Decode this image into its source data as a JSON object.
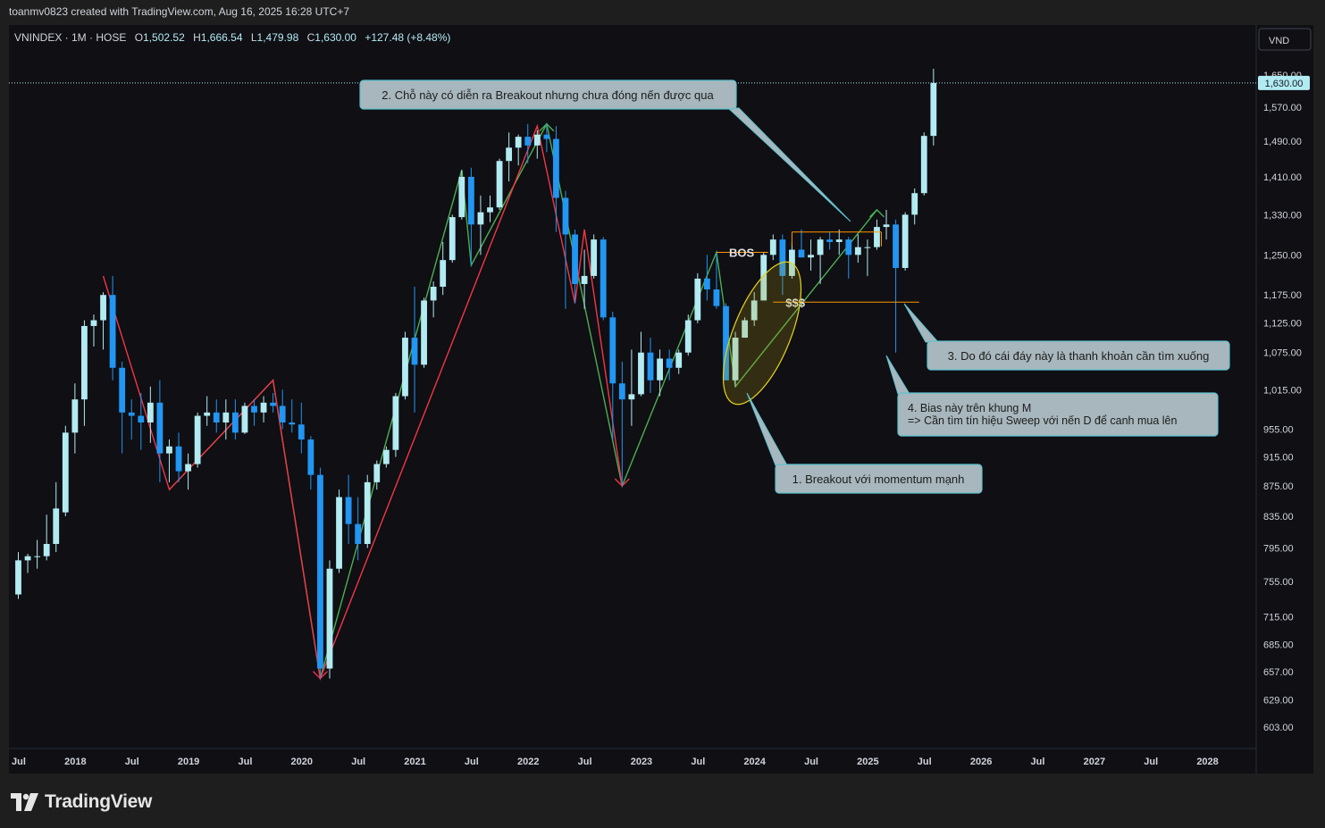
{
  "header": {
    "text": "toanmv0823 created with TradingView.com, Aug 16, 2025 16:28 UTC+7"
  },
  "legend": {
    "symbol": "VNINDEX · 1M · HOSE",
    "o_label": "O",
    "o_value": "1,502.52",
    "h_label": "H",
    "h_value": "1,666.54",
    "l_label": "L",
    "l_value": "1,479.98",
    "c_label": "C",
    "c_value": "1,630.00",
    "change": "+127.48 (+8.48%)"
  },
  "currency": "VND",
  "price_badge": "1,630.00",
  "footer": {
    "brand": "TradingView"
  },
  "colors": {
    "bg": "#0f0f14",
    "up": "#b2ebf2",
    "down": "#2196f3",
    "green_line": "#4caf50",
    "red_line": "#f23645",
    "annotation_bg": "#a8b7bd",
    "annotation_border": "#5dc2d0",
    "highlight_ellipse": "#e6d21a",
    "level_line": "#ff9800"
  },
  "chart_data": {
    "type": "candlestick",
    "symbol": "VNINDEX",
    "timeframe": "1M",
    "y_axis": {
      "scale": "log",
      "ticks": [
        "1,650.00",
        "1,570.00",
        "1,490.00",
        "1,410.00",
        "1,330.00",
        "1,250.00",
        "1,175.00",
        "1,125.00",
        "1,075.00",
        "1,015.00",
        "955.00",
        "915.00",
        "875.00",
        "835.00",
        "795.00",
        "755.00",
        "715.00",
        "685.00",
        "657.00",
        "629.00",
        "603.00"
      ]
    },
    "x_axis": {
      "ticks": [
        "Jul",
        "2018",
        "Jul",
        "2019",
        "Jul",
        "2020",
        "Jul",
        "2021",
        "Jul",
        "2022",
        "Jul",
        "2023",
        "Jul",
        "2024",
        "Jul",
        "2025",
        "Jul",
        "2026",
        "Jul",
        "2027",
        "Jul",
        "2028"
      ]
    },
    "candles": [
      {
        "t": "2017-07",
        "o": 740,
        "h": 790,
        "l": 735,
        "c": 780
      },
      {
        "t": "2017-08",
        "o": 780,
        "h": 788,
        "l": 765,
        "c": 785
      },
      {
        "t": "2017-09",
        "o": 785,
        "h": 805,
        "l": 770,
        "c": 785
      },
      {
        "t": "2017-10",
        "o": 785,
        "h": 837,
        "l": 780,
        "c": 800
      },
      {
        "t": "2017-11",
        "o": 800,
        "h": 880,
        "l": 790,
        "c": 845
      },
      {
        "t": "2017-12",
        "o": 840,
        "h": 960,
        "l": 835,
        "c": 950
      },
      {
        "t": "2018-01",
        "o": 950,
        "h": 1025,
        "l": 920,
        "c": 1000
      },
      {
        "t": "2018-02",
        "o": 1000,
        "h": 1130,
        "l": 960,
        "c": 1120
      },
      {
        "t": "2018-03",
        "o": 1120,
        "h": 1140,
        "l": 1085,
        "c": 1130
      },
      {
        "t": "2018-04",
        "o": 1130,
        "h": 1180,
        "l": 1080,
        "c": 1175
      },
      {
        "t": "2018-05",
        "o": 1175,
        "h": 1210,
        "l": 1030,
        "c": 1050
      },
      {
        "t": "2018-06",
        "o": 1050,
        "h": 1060,
        "l": 920,
        "c": 980
      },
      {
        "t": "2018-07",
        "o": 980,
        "h": 1000,
        "l": 940,
        "c": 975
      },
      {
        "t": "2018-08",
        "o": 975,
        "h": 1010,
        "l": 925,
        "c": 965
      },
      {
        "t": "2018-09",
        "o": 965,
        "h": 1020,
        "l": 935,
        "c": 995
      },
      {
        "t": "2018-10",
        "o": 995,
        "h": 1030,
        "l": 880,
        "c": 920
      },
      {
        "t": "2018-11",
        "o": 920,
        "h": 940,
        "l": 880,
        "c": 930
      },
      {
        "t": "2018-12",
        "o": 930,
        "h": 950,
        "l": 880,
        "c": 895
      },
      {
        "t": "2019-01",
        "o": 895,
        "h": 920,
        "l": 870,
        "c": 905
      },
      {
        "t": "2019-02",
        "o": 905,
        "h": 980,
        "l": 900,
        "c": 975
      },
      {
        "t": "2019-03",
        "o": 975,
        "h": 1005,
        "l": 960,
        "c": 980
      },
      {
        "t": "2019-04",
        "o": 980,
        "h": 1000,
        "l": 950,
        "c": 965
      },
      {
        "t": "2019-05",
        "o": 965,
        "h": 1000,
        "l": 940,
        "c": 980
      },
      {
        "t": "2019-06",
        "o": 980,
        "h": 1000,
        "l": 940,
        "c": 950
      },
      {
        "t": "2019-07",
        "o": 950,
        "h": 995,
        "l": 948,
        "c": 990
      },
      {
        "t": "2019-08",
        "o": 990,
        "h": 1000,
        "l": 960,
        "c": 980
      },
      {
        "t": "2019-09",
        "o": 980,
        "h": 1005,
        "l": 965,
        "c": 995
      },
      {
        "t": "2019-10",
        "o": 995,
        "h": 1010,
        "l": 980,
        "c": 990
      },
      {
        "t": "2019-11",
        "o": 990,
        "h": 1015,
        "l": 955,
        "c": 965
      },
      {
        "t": "2019-12",
        "o": 965,
        "h": 1000,
        "l": 950,
        "c": 962
      },
      {
        "t": "2020-01",
        "o": 962,
        "h": 995,
        "l": 920,
        "c": 940
      },
      {
        "t": "2020-02",
        "o": 940,
        "h": 945,
        "l": 870,
        "c": 890
      },
      {
        "t": "2020-03",
        "o": 890,
        "h": 900,
        "l": 650,
        "c": 660
      },
      {
        "t": "2020-04",
        "o": 660,
        "h": 780,
        "l": 650,
        "c": 770
      },
      {
        "t": "2020-05",
        "o": 770,
        "h": 870,
        "l": 765,
        "c": 860
      },
      {
        "t": "2020-06",
        "o": 860,
        "h": 890,
        "l": 800,
        "c": 825
      },
      {
        "t": "2020-07",
        "o": 825,
        "h": 860,
        "l": 780,
        "c": 800
      },
      {
        "t": "2020-08",
        "o": 800,
        "h": 890,
        "l": 795,
        "c": 880
      },
      {
        "t": "2020-09",
        "o": 880,
        "h": 910,
        "l": 870,
        "c": 905
      },
      {
        "t": "2020-10",
        "o": 905,
        "h": 930,
        "l": 900,
        "c": 925
      },
      {
        "t": "2020-11",
        "o": 925,
        "h": 1010,
        "l": 915,
        "c": 1005
      },
      {
        "t": "2020-12",
        "o": 1005,
        "h": 1110,
        "l": 1000,
        "c": 1100
      },
      {
        "t": "2021-01",
        "o": 1100,
        "h": 1190,
        "l": 980,
        "c": 1055
      },
      {
        "t": "2021-02",
        "o": 1055,
        "h": 1170,
        "l": 1050,
        "c": 1165
      },
      {
        "t": "2021-03",
        "o": 1165,
        "h": 1200,
        "l": 1135,
        "c": 1190
      },
      {
        "t": "2021-04",
        "o": 1190,
        "h": 1275,
        "l": 1175,
        "c": 1240
      },
      {
        "t": "2021-05",
        "o": 1240,
        "h": 1330,
        "l": 1235,
        "c": 1325
      },
      {
        "t": "2021-06",
        "o": 1325,
        "h": 1425,
        "l": 1320,
        "c": 1410
      },
      {
        "t": "2021-07",
        "o": 1410,
        "h": 1430,
        "l": 1230,
        "c": 1310
      },
      {
        "t": "2021-08",
        "o": 1310,
        "h": 1370,
        "l": 1250,
        "c": 1335
      },
      {
        "t": "2021-09",
        "o": 1335,
        "h": 1370,
        "l": 1315,
        "c": 1345
      },
      {
        "t": "2021-10",
        "o": 1345,
        "h": 1450,
        "l": 1340,
        "c": 1445
      },
      {
        "t": "2021-11",
        "o": 1445,
        "h": 1510,
        "l": 1400,
        "c": 1475
      },
      {
        "t": "2021-12",
        "o": 1475,
        "h": 1505,
        "l": 1435,
        "c": 1500
      },
      {
        "t": "2022-01",
        "o": 1500,
        "h": 1530,
        "l": 1440,
        "c": 1480
      },
      {
        "t": "2022-02",
        "o": 1480,
        "h": 1515,
        "l": 1450,
        "c": 1505
      },
      {
        "t": "2022-03",
        "o": 1505,
        "h": 1530,
        "l": 1465,
        "c": 1495
      },
      {
        "t": "2022-04",
        "o": 1495,
        "h": 1525,
        "l": 1295,
        "c": 1365
      },
      {
        "t": "2022-05",
        "o": 1365,
        "h": 1380,
        "l": 1150,
        "c": 1290
      },
      {
        "t": "2022-06",
        "o": 1290,
        "h": 1300,
        "l": 1160,
        "c": 1195
      },
      {
        "t": "2022-07",
        "o": 1195,
        "h": 1260,
        "l": 1150,
        "c": 1210
      },
      {
        "t": "2022-08",
        "o": 1210,
        "h": 1290,
        "l": 1205,
        "c": 1280
      },
      {
        "t": "2022-09",
        "o": 1280,
        "h": 1285,
        "l": 1130,
        "c": 1135
      },
      {
        "t": "2022-10",
        "o": 1135,
        "h": 1145,
        "l": 940,
        "c": 1025
      },
      {
        "t": "2022-11",
        "o": 1025,
        "h": 1060,
        "l": 875,
        "c": 1000
      },
      {
        "t": "2022-12",
        "o": 1000,
        "h": 1080,
        "l": 960,
        "c": 1008
      },
      {
        "t": "2023-01",
        "o": 1008,
        "h": 1110,
        "l": 1005,
        "c": 1075
      },
      {
        "t": "2023-02",
        "o": 1075,
        "h": 1100,
        "l": 1010,
        "c": 1030
      },
      {
        "t": "2023-03",
        "o": 1030,
        "h": 1080,
        "l": 1005,
        "c": 1065
      },
      {
        "t": "2023-04",
        "o": 1065,
        "h": 1080,
        "l": 1030,
        "c": 1050
      },
      {
        "t": "2023-05",
        "o": 1050,
        "h": 1080,
        "l": 1040,
        "c": 1075
      },
      {
        "t": "2023-06",
        "o": 1075,
        "h": 1140,
        "l": 1070,
        "c": 1130
      },
      {
        "t": "2023-07",
        "o": 1130,
        "h": 1215,
        "l": 1125,
        "c": 1205
      },
      {
        "t": "2023-08",
        "o": 1205,
        "h": 1250,
        "l": 1165,
        "c": 1185
      },
      {
        "t": "2023-09",
        "o": 1185,
        "h": 1255,
        "l": 1150,
        "c": 1155
      },
      {
        "t": "2023-10",
        "o": 1155,
        "h": 1160,
        "l": 1030,
        "c": 1030
      },
      {
        "t": "2023-11",
        "o": 1030,
        "h": 1110,
        "l": 1020,
        "c": 1100
      },
      {
        "t": "2023-12",
        "o": 1100,
        "h": 1135,
        "l": 1100,
        "c": 1130
      },
      {
        "t": "2024-01",
        "o": 1130,
        "h": 1180,
        "l": 1120,
        "c": 1165
      },
      {
        "t": "2024-02",
        "o": 1165,
        "h": 1255,
        "l": 1165,
        "c": 1250
      },
      {
        "t": "2024-03",
        "o": 1250,
        "h": 1290,
        "l": 1240,
        "c": 1280
      },
      {
        "t": "2024-04",
        "o": 1280,
        "h": 1290,
        "l": 1175,
        "c": 1210
      },
      {
        "t": "2024-05",
        "o": 1210,
        "h": 1275,
        "l": 1205,
        "c": 1260
      },
      {
        "t": "2024-06",
        "o": 1260,
        "h": 1300,
        "l": 1245,
        "c": 1245
      },
      {
        "t": "2024-07",
        "o": 1245,
        "h": 1280,
        "l": 1220,
        "c": 1250
      },
      {
        "t": "2024-08",
        "o": 1250,
        "h": 1285,
        "l": 1195,
        "c": 1280
      },
      {
        "t": "2024-09",
        "o": 1280,
        "h": 1295,
        "l": 1260,
        "c": 1275
      },
      {
        "t": "2024-10",
        "o": 1275,
        "h": 1300,
        "l": 1250,
        "c": 1280
      },
      {
        "t": "2024-11",
        "o": 1280,
        "h": 1285,
        "l": 1205,
        "c": 1250
      },
      {
        "t": "2024-12",
        "o": 1250,
        "h": 1290,
        "l": 1235,
        "c": 1265
      },
      {
        "t": "2025-01",
        "o": 1265,
        "h": 1280,
        "l": 1210,
        "c": 1265
      },
      {
        "t": "2025-02",
        "o": 1265,
        "h": 1320,
        "l": 1260,
        "c": 1305
      },
      {
        "t": "2025-03",
        "o": 1305,
        "h": 1340,
        "l": 1280,
        "c": 1310
      },
      {
        "t": "2025-04",
        "o": 1310,
        "h": 1320,
        "l": 1075,
        "c": 1225
      },
      {
        "t": "2025-05",
        "o": 1225,
        "h": 1335,
        "l": 1220,
        "c": 1330
      },
      {
        "t": "2025-06",
        "o": 1330,
        "h": 1385,
        "l": 1310,
        "c": 1375
      },
      {
        "t": "2025-07",
        "o": 1375,
        "h": 1510,
        "l": 1370,
        "c": 1502
      },
      {
        "t": "2025-08",
        "o": 1502,
        "h": 1666,
        "l": 1480,
        "c": 1630
      }
    ],
    "zigzag_green": [
      {
        "t": "2018-11",
        "p": 870
      },
      {
        "t": "2019-10",
        "p": 1030
      },
      {
        "t": "2020-03",
        "p": 650
      },
      {
        "t": "2021-06",
        "p": 1425
      },
      {
        "t": "2021-07",
        "p": 1230
      },
      {
        "t": "2022-03",
        "p": 1530
      },
      {
        "t": "2022-11",
        "p": 875
      },
      {
        "t": "2023-09",
        "p": 1255
      },
      {
        "t": "2023-11",
        "p": 1020
      },
      {
        "t": "2025-02",
        "p": 1340
      }
    ],
    "zigzag_red": [
      {
        "t": "2018-04",
        "p": 1210
      },
      {
        "t": "2018-11",
        "p": 870
      },
      {
        "t": "2019-10",
        "p": 1030
      },
      {
        "t": "2020-03",
        "p": 650
      },
      {
        "t": "2022-02",
        "p": 1525
      },
      {
        "t": "2022-06",
        "p": 1160
      },
      {
        "t": "2022-07",
        "p": 1300
      },
      {
        "t": "2022-11",
        "p": 875
      }
    ],
    "levels": [
      {
        "label": "BOS",
        "price": 1255,
        "from": "2023-09",
        "to": "2024-02"
      },
      {
        "label": "",
        "price": 1295,
        "from": "2024-05",
        "to": "2025-02"
      },
      {
        "label": "$$$",
        "price": 1162,
        "from": "2024-03",
        "to": "2025-06"
      }
    ],
    "annotations": [
      {
        "text": "2. Chỗ này có diễn ra Breakout nhưng chưa đóng nến được qua"
      },
      {
        "text": "3. Do đó cái đáy này là thanh khoản cần tìm xuống"
      },
      {
        "lines": [
          "4. Bias này trên khung M",
          "=> Cần tìm tín hiệu Sweep với nến D để canh mua lên"
        ]
      },
      {
        "text": "1. Breakout với momentum mạnh"
      }
    ]
  }
}
